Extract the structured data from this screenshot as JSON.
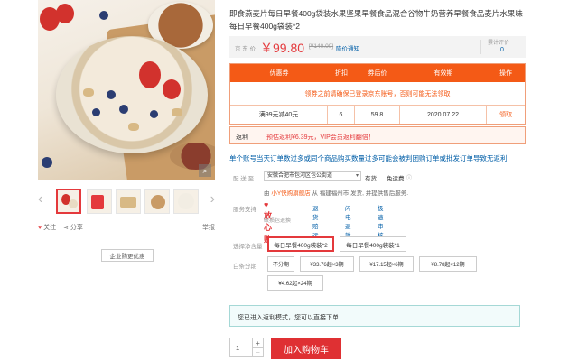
{
  "gallery": {
    "zoom_icon": "magnifier-icon",
    "prev_icon": "chevron-left-icon",
    "next_icon": "chevron-right-icon",
    "prev_glyph": "‹",
    "next_glyph": "›",
    "follow_label": "关注",
    "share_label": "分享",
    "report_label": "举报",
    "enterprise_label": "企业购更优惠"
  },
  "product": {
    "title": "即食燕麦片每日早餐400g袋装水果坚果早餐食品混合谷物牛奶营养早餐食品麦片水果味 每日早餐400g袋装*2",
    "price_label": "京 东 价",
    "price": "￥99.80",
    "original_price": "[¥140.00]",
    "price_notify": "降价通知",
    "review_label": "累计评价",
    "review_count": "0"
  },
  "coupon": {
    "headers": [
      "优惠券",
      "折扣",
      "券后价",
      "有效期",
      "操作"
    ],
    "note": "领券之前请确保已登录京东账号，否则可能无法领取",
    "row": [
      "满99元减40元",
      "6",
      "59.8",
      "2020.07.22",
      "领取"
    ]
  },
  "rebate": {
    "label": "返利",
    "text": "预估返利¥6.39元，VIP会员返利翻倍！"
  },
  "promo": "单个账号当天订单数过多或同个商品购买数量过多可能会被判团购订单或批发订单导致无返利",
  "delivery": {
    "label": "配 送 至",
    "address": "安徽合肥市包河区包公街道",
    "stock": "有货",
    "freight": "免运费",
    "ship_prefix": "由",
    "store": "小Y快购旗舰店",
    "ship_suffix": "从 福建福州市 发货, 并提供售后服务.",
    "arrow": "▾"
  },
  "service": {
    "label": "服务支持",
    "fangxin": "♥放心购",
    "items": [
      "退货赔运",
      "闪电退款",
      "极速审核"
    ],
    "sub": "破损包退换"
  },
  "variants": {
    "label": "选择净含量",
    "options": [
      "每日早餐400g袋装*2",
      "每日早餐400g袋装*1"
    ]
  },
  "installment": {
    "label": "白条分期",
    "options": [
      "不分期",
      "¥33.76起×3期",
      "¥17.15起×6期",
      "¥8.78起×12期",
      "¥4.62起×24期"
    ]
  },
  "notice": "您已进入返利模式，您可以直接下单",
  "quantity": "1",
  "cart_label": "加入购物车",
  "colors": {
    "accent": "#e4393c",
    "coupon_orange": "#f45a16",
    "link": "#005ea7"
  }
}
